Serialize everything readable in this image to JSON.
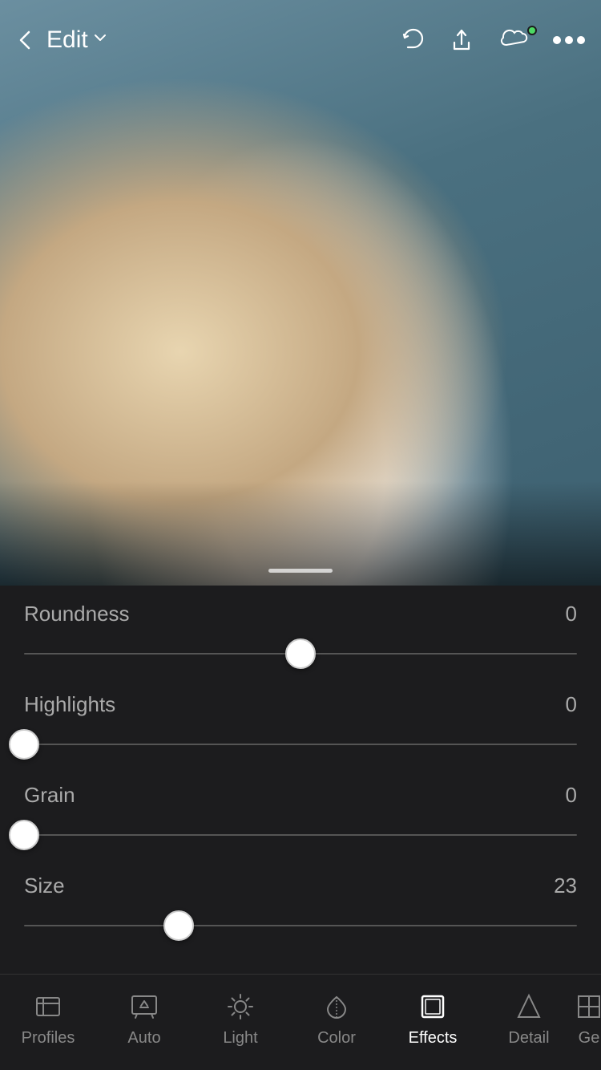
{
  "toolbar": {
    "back_label": "‹",
    "edit_label": "Edit",
    "chevron": "▾",
    "undo_label": "↩",
    "share_label": "⬆",
    "more_label": "···"
  },
  "sliders": [
    {
      "id": "roundness",
      "label": "Roundness",
      "value": "0",
      "thumb_percent": 50
    },
    {
      "id": "highlights",
      "label": "Highlights",
      "value": "0",
      "thumb_percent": 0
    },
    {
      "id": "grain",
      "label": "Grain",
      "value": "0",
      "thumb_percent": 0
    },
    {
      "id": "size",
      "label": "Size",
      "value": "23",
      "thumb_percent": 28
    }
  ],
  "nav": {
    "items": [
      {
        "id": "profiles",
        "label": "Profiles",
        "active": false
      },
      {
        "id": "auto",
        "label": "Auto",
        "active": false
      },
      {
        "id": "light",
        "label": "Light",
        "active": false
      },
      {
        "id": "color",
        "label": "Color",
        "active": false
      },
      {
        "id": "effects",
        "label": "Effects",
        "active": true
      },
      {
        "id": "detail",
        "label": "Detail",
        "active": false
      },
      {
        "id": "geometry",
        "label": "Ge",
        "active": false
      }
    ]
  }
}
